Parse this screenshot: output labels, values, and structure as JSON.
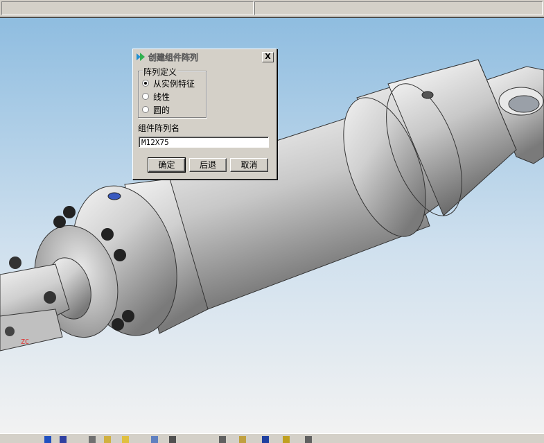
{
  "dialog": {
    "title": "创建组件阵列",
    "close_label": "X",
    "group_label": "阵列定义",
    "options": [
      {
        "label": "从实例特征",
        "selected": true
      },
      {
        "label": "线性",
        "selected": false
      },
      {
        "label": "圆的",
        "selected": false
      }
    ],
    "name_label": "组件阵列名",
    "name_value": "M12X75",
    "buttons": {
      "ok": "确定",
      "back": "后退",
      "cancel": "取消"
    }
  },
  "viewport": {
    "axis_label": "ZC",
    "bg_top": "#8fbde0",
    "bg_bottom": "#f2f2f2"
  },
  "icons": [
    "app-logo-icon",
    "close-icon"
  ]
}
